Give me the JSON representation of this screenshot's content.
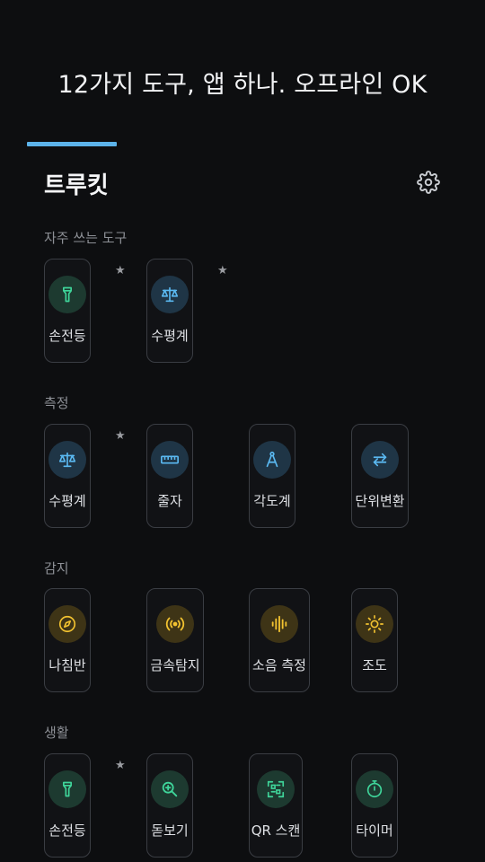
{
  "headline": "12가지 도구, 앱 하나. 오프라인 OK",
  "app": {
    "title": "트루킷",
    "settings_icon": "gear-icon"
  },
  "colors": {
    "accent": "#5cb3ea",
    "green": "#3fd59a",
    "blue": "#5ab8f0",
    "gold": "#f2c230"
  },
  "favorites": {
    "label": "자주 쓰는 도구",
    "items": [
      {
        "label": "손전등",
        "icon": "flashlight-icon",
        "starred": true
      },
      {
        "label": "수평계",
        "icon": "scale-icon",
        "starred": true
      }
    ]
  },
  "measure": {
    "label": "측정",
    "items": [
      {
        "label": "수평계",
        "icon": "scale-icon",
        "starred": true
      },
      {
        "label": "줄자",
        "icon": "ruler-icon"
      },
      {
        "label": "각도계",
        "icon": "compass-drafting-icon"
      },
      {
        "label": "단위변환",
        "icon": "swap-arrows-icon"
      }
    ]
  },
  "sense": {
    "label": "감지",
    "items": [
      {
        "label": "나침반",
        "icon": "compass-icon"
      },
      {
        "label": "금속탐지",
        "icon": "signal-waves-icon"
      },
      {
        "label": "소음 측정",
        "icon": "sound-wave-icon"
      },
      {
        "label": "조도",
        "icon": "sun-icon"
      }
    ]
  },
  "life": {
    "label": "생활",
    "items": [
      {
        "label": "손전등",
        "icon": "flashlight-icon",
        "starred": true
      },
      {
        "label": "돋보기",
        "icon": "magnifier-icon"
      },
      {
        "label": "QR 스캔",
        "icon": "qr-scan-icon"
      },
      {
        "label": "타이머",
        "icon": "timer-icon"
      }
    ]
  },
  "star_glyph": "★"
}
